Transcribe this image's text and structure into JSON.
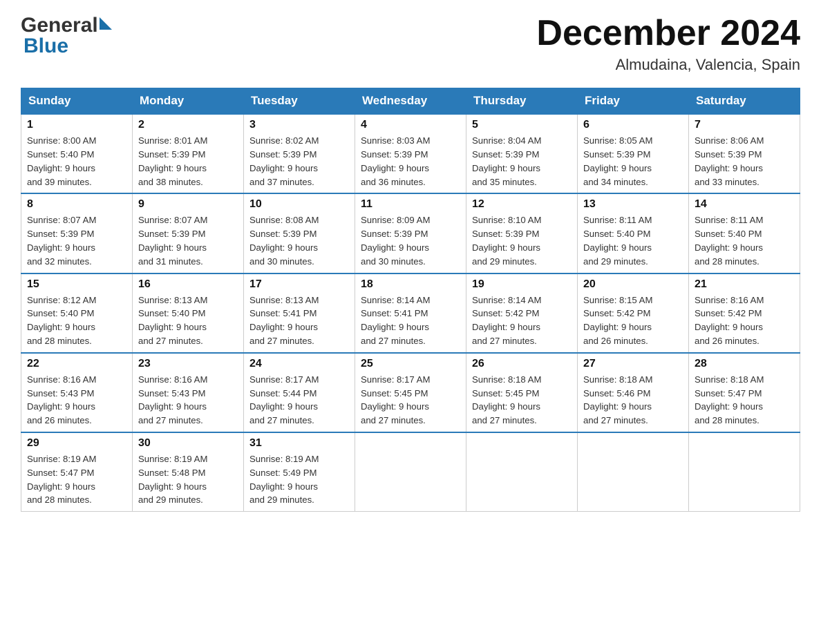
{
  "header": {
    "title": "December 2024",
    "location": "Almudaina, Valencia, Spain",
    "logo_general": "General",
    "logo_blue": "Blue"
  },
  "weekdays": [
    "Sunday",
    "Monday",
    "Tuesday",
    "Wednesday",
    "Thursday",
    "Friday",
    "Saturday"
  ],
  "weeks": [
    [
      {
        "day": "1",
        "sunrise": "8:00 AM",
        "sunset": "5:40 PM",
        "daylight": "9 hours and 39 minutes."
      },
      {
        "day": "2",
        "sunrise": "8:01 AM",
        "sunset": "5:39 PM",
        "daylight": "9 hours and 38 minutes."
      },
      {
        "day": "3",
        "sunrise": "8:02 AM",
        "sunset": "5:39 PM",
        "daylight": "9 hours and 37 minutes."
      },
      {
        "day": "4",
        "sunrise": "8:03 AM",
        "sunset": "5:39 PM",
        "daylight": "9 hours and 36 minutes."
      },
      {
        "day": "5",
        "sunrise": "8:04 AM",
        "sunset": "5:39 PM",
        "daylight": "9 hours and 35 minutes."
      },
      {
        "day": "6",
        "sunrise": "8:05 AM",
        "sunset": "5:39 PM",
        "daylight": "9 hours and 34 minutes."
      },
      {
        "day": "7",
        "sunrise": "8:06 AM",
        "sunset": "5:39 PM",
        "daylight": "9 hours and 33 minutes."
      }
    ],
    [
      {
        "day": "8",
        "sunrise": "8:07 AM",
        "sunset": "5:39 PM",
        "daylight": "9 hours and 32 minutes."
      },
      {
        "day": "9",
        "sunrise": "8:07 AM",
        "sunset": "5:39 PM",
        "daylight": "9 hours and 31 minutes."
      },
      {
        "day": "10",
        "sunrise": "8:08 AM",
        "sunset": "5:39 PM",
        "daylight": "9 hours and 30 minutes."
      },
      {
        "day": "11",
        "sunrise": "8:09 AM",
        "sunset": "5:39 PM",
        "daylight": "9 hours and 30 minutes."
      },
      {
        "day": "12",
        "sunrise": "8:10 AM",
        "sunset": "5:39 PM",
        "daylight": "9 hours and 29 minutes."
      },
      {
        "day": "13",
        "sunrise": "8:11 AM",
        "sunset": "5:40 PM",
        "daylight": "9 hours and 29 minutes."
      },
      {
        "day": "14",
        "sunrise": "8:11 AM",
        "sunset": "5:40 PM",
        "daylight": "9 hours and 28 minutes."
      }
    ],
    [
      {
        "day": "15",
        "sunrise": "8:12 AM",
        "sunset": "5:40 PM",
        "daylight": "9 hours and 28 minutes."
      },
      {
        "day": "16",
        "sunrise": "8:13 AM",
        "sunset": "5:40 PM",
        "daylight": "9 hours and 27 minutes."
      },
      {
        "day": "17",
        "sunrise": "8:13 AM",
        "sunset": "5:41 PM",
        "daylight": "9 hours and 27 minutes."
      },
      {
        "day": "18",
        "sunrise": "8:14 AM",
        "sunset": "5:41 PM",
        "daylight": "9 hours and 27 minutes."
      },
      {
        "day": "19",
        "sunrise": "8:14 AM",
        "sunset": "5:42 PM",
        "daylight": "9 hours and 27 minutes."
      },
      {
        "day": "20",
        "sunrise": "8:15 AM",
        "sunset": "5:42 PM",
        "daylight": "9 hours and 26 minutes."
      },
      {
        "day": "21",
        "sunrise": "8:16 AM",
        "sunset": "5:42 PM",
        "daylight": "9 hours and 26 minutes."
      }
    ],
    [
      {
        "day": "22",
        "sunrise": "8:16 AM",
        "sunset": "5:43 PM",
        "daylight": "9 hours and 26 minutes."
      },
      {
        "day": "23",
        "sunrise": "8:16 AM",
        "sunset": "5:43 PM",
        "daylight": "9 hours and 27 minutes."
      },
      {
        "day": "24",
        "sunrise": "8:17 AM",
        "sunset": "5:44 PM",
        "daylight": "9 hours and 27 minutes."
      },
      {
        "day": "25",
        "sunrise": "8:17 AM",
        "sunset": "5:45 PM",
        "daylight": "9 hours and 27 minutes."
      },
      {
        "day": "26",
        "sunrise": "8:18 AM",
        "sunset": "5:45 PM",
        "daylight": "9 hours and 27 minutes."
      },
      {
        "day": "27",
        "sunrise": "8:18 AM",
        "sunset": "5:46 PM",
        "daylight": "9 hours and 27 minutes."
      },
      {
        "day": "28",
        "sunrise": "8:18 AM",
        "sunset": "5:47 PM",
        "daylight": "9 hours and 28 minutes."
      }
    ],
    [
      {
        "day": "29",
        "sunrise": "8:19 AM",
        "sunset": "5:47 PM",
        "daylight": "9 hours and 28 minutes."
      },
      {
        "day": "30",
        "sunrise": "8:19 AM",
        "sunset": "5:48 PM",
        "daylight": "9 hours and 29 minutes."
      },
      {
        "day": "31",
        "sunrise": "8:19 AM",
        "sunset": "5:49 PM",
        "daylight": "9 hours and 29 minutes."
      },
      null,
      null,
      null,
      null
    ]
  ],
  "labels": {
    "sunrise": "Sunrise:",
    "sunset": "Sunset:",
    "daylight": "Daylight:"
  }
}
